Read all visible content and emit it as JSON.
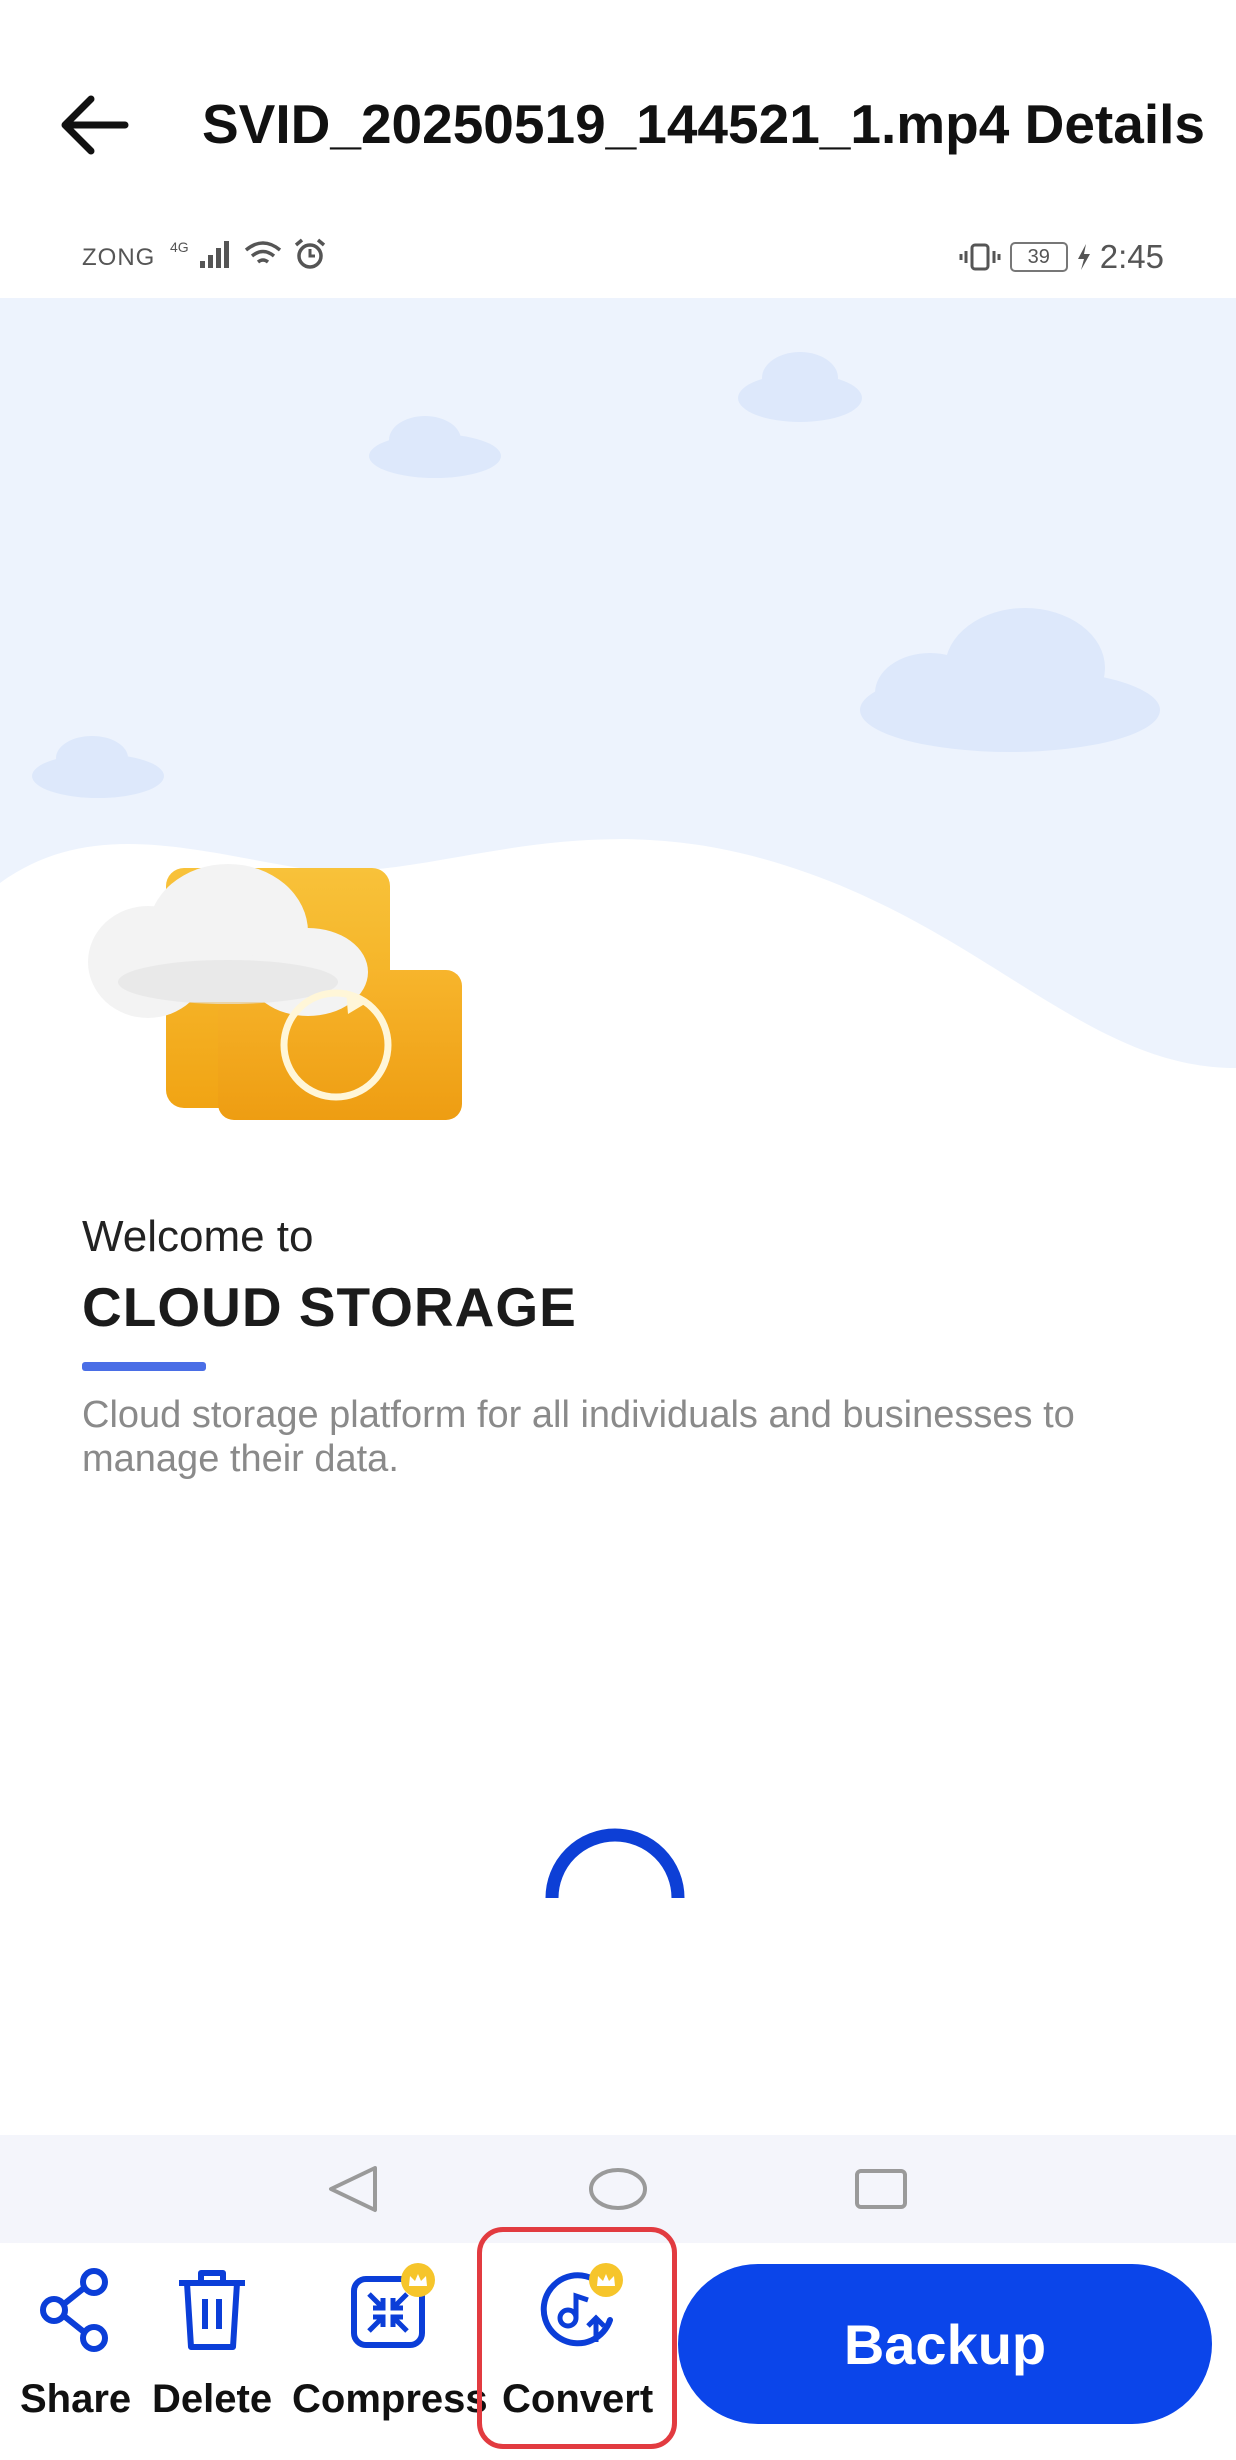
{
  "header": {
    "back_icon": "arrow-left-icon",
    "title": "SVID_20250519_144521_1.mp4 Details"
  },
  "status_bar": {
    "carrier": "ZONG",
    "network": "4G",
    "battery": "39",
    "time": "2:45"
  },
  "onboarding": {
    "welcome": "Welcome to",
    "headline": "CLOUD STORAGE",
    "description": "Cloud storage platform for all individuals and businesses to manage their data.",
    "accent_color": "#4a6ee6"
  },
  "toolbar": {
    "items": [
      {
        "label": "Share",
        "icon": "share-icon",
        "premium": false
      },
      {
        "label": "Delete",
        "icon": "trash-icon",
        "premium": false
      },
      {
        "label": "Compress",
        "icon": "compress-icon",
        "premium": true
      },
      {
        "label": "Convert",
        "icon": "convert-audio-icon",
        "premium": true
      }
    ],
    "backup_label": "Backup",
    "highlighted_item": "Convert",
    "primary_color": "#0b45ea",
    "highlight_color": "#e23b40"
  }
}
